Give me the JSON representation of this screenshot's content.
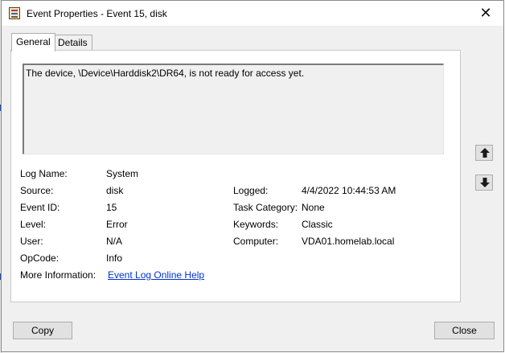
{
  "window": {
    "title": "Event Properties - Event 15, disk",
    "close_glyph": "✕"
  },
  "tabs": [
    {
      "label": "General",
      "active": true
    },
    {
      "label": "Details",
      "active": false
    }
  ],
  "event": {
    "description": "The device, \\Device\\Harddisk2\\DR64, is not ready for access yet.",
    "fields_left": [
      {
        "label": "Log Name:",
        "value": "System"
      },
      {
        "label": "Source:",
        "value": "disk"
      },
      {
        "label": "Event ID:",
        "value": "15"
      },
      {
        "label": "Level:",
        "value": "Error"
      },
      {
        "label": "User:",
        "value": "N/A"
      },
      {
        "label": "OpCode:",
        "value": "Info"
      }
    ],
    "fields_right": [
      {
        "label": "Logged:",
        "value": "4/4/2022 10:44:53 AM"
      },
      {
        "label": "Task Category:",
        "value": "None"
      },
      {
        "label": "Keywords:",
        "value": "Classic"
      },
      {
        "label": "Computer:",
        "value": "VDA01.homelab.local"
      }
    ],
    "more_info": {
      "label": "More Information:",
      "link_text": "Event Log Online Help"
    }
  },
  "nav": {
    "up_icon": "arrow-up-icon",
    "down_icon": "arrow-down-icon"
  },
  "buttons": {
    "copy": "Copy",
    "close": "Close"
  },
  "colors": {
    "window_bg": "#f0f0f0",
    "panel_bg": "#ffffff",
    "link": "#0033cc",
    "button_bg": "#e1e1e1"
  }
}
